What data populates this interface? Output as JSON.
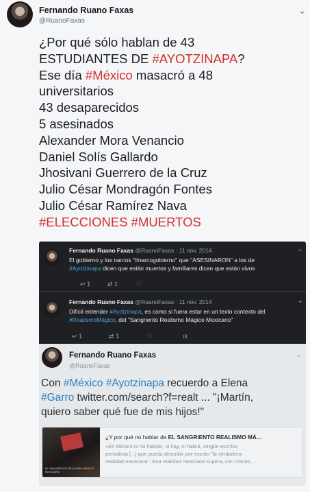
{
  "tweet": {
    "author_name": "Fernando Ruano Faxas",
    "author_handle": "@RuanoFaxas",
    "lines": [
      {
        "text": "¿Por qué sólo hablan de 43",
        "parts": []
      },
      {
        "parts": [
          {
            "t": "ESTUDIANTES DE ",
            "c": ""
          },
          {
            "t": "#AYOTZINAPA",
            "c": "red"
          },
          {
            "t": "?",
            "c": ""
          }
        ]
      },
      {
        "parts": [
          {
            "t": "Ese día ",
            "c": ""
          },
          {
            "t": "#México",
            "c": "red"
          },
          {
            "t": " masacró a 48",
            "c": ""
          }
        ]
      },
      {
        "text": "universitarios",
        "parts": []
      },
      {
        "text": "43 desaparecidos",
        "parts": []
      },
      {
        "text": "5 asesinados",
        "parts": []
      },
      {
        "text": "Alexander Mora Venancio",
        "parts": []
      },
      {
        "text": "Daniel Solís Gallardo",
        "parts": []
      },
      {
        "text": "Jhosivani Guerrero de la Cruz",
        "parts": []
      },
      {
        "text": "Julio César Mondragón Fontes",
        "parts": []
      },
      {
        "text": "Julio César Ramírez Nava",
        "parts": []
      },
      {
        "parts": [
          {
            "t": "#ELECCIONES #MUERTOS",
            "c": "red"
          }
        ]
      }
    ]
  },
  "quoted_1": {
    "name": "Fernando Ruano Faxas",
    "meta": "@RuanoFaxas · 11 nov. 2014",
    "line1": "El gobierno y los narcos \"#narcogobierno\" que \"ASESINARON\" a los de",
    "line2_tag": "#Ayotzinapa",
    "line2_rest": " dicen que están muertos y familiares dicen que están vivos",
    "reply_count": "1",
    "retweet_count": "1"
  },
  "quoted_2": {
    "name": "Fernando Ruano Faxas",
    "meta": "@RuanoFaxas · 11 nov. 2014",
    "line1_pre": "Difícil entender ",
    "line1_tag": "#Ayotzinapa",
    "line1_rest": ", es como si fuera estar en un texto contexto del",
    "line2_tag": "#RealismoMágico",
    "line2_rest": ", del \"Sangriento Realismo Mágico Mexicano\"",
    "reply_count": "1",
    "retweet_count": "1"
  },
  "retweet": {
    "name": "Fernando Ruano Faxas",
    "handle": "@RuanoFaxas",
    "text_l1_pre": "Con ",
    "text_l1_tag1": "#México",
    "text_l1_mid": " ",
    "text_l1_tag2": "#Ayotzinapa",
    "text_l1_rest": " recuerdo a Elena",
    "text_l2_tag": "#Garro",
    "text_l2_rest": " twitter.com/search?f=realt ... \"¡Martín,",
    "text_l3": "quiero saber qué fue de mis hijos!\""
  },
  "card": {
    "title_pre": "¿Y por qué no hablar de ",
    "title_bold": "EL SANGRIENTO REALISMO MÁ...",
    "desc": [
      "«En México ni ha habido, ni hay, ni habrá, ningún escritor,",
      "periodista [...] que pueda describir por escrito \"la verdadera",
      "realidad mexicana\". Esa realidad mexicana supera, con creces, ..."
    ],
    "image_caption": "EL SANGRIENTO REALISMO MÁGICO MEXICANO"
  },
  "icons": {
    "reply": "↩",
    "retweet": "⇄",
    "like": "♡",
    "stats": "ılı",
    "chevron": "⌄"
  },
  "colors": {
    "hashtag_red": "#d0312d",
    "link_blue": "#2a7fc0"
  }
}
